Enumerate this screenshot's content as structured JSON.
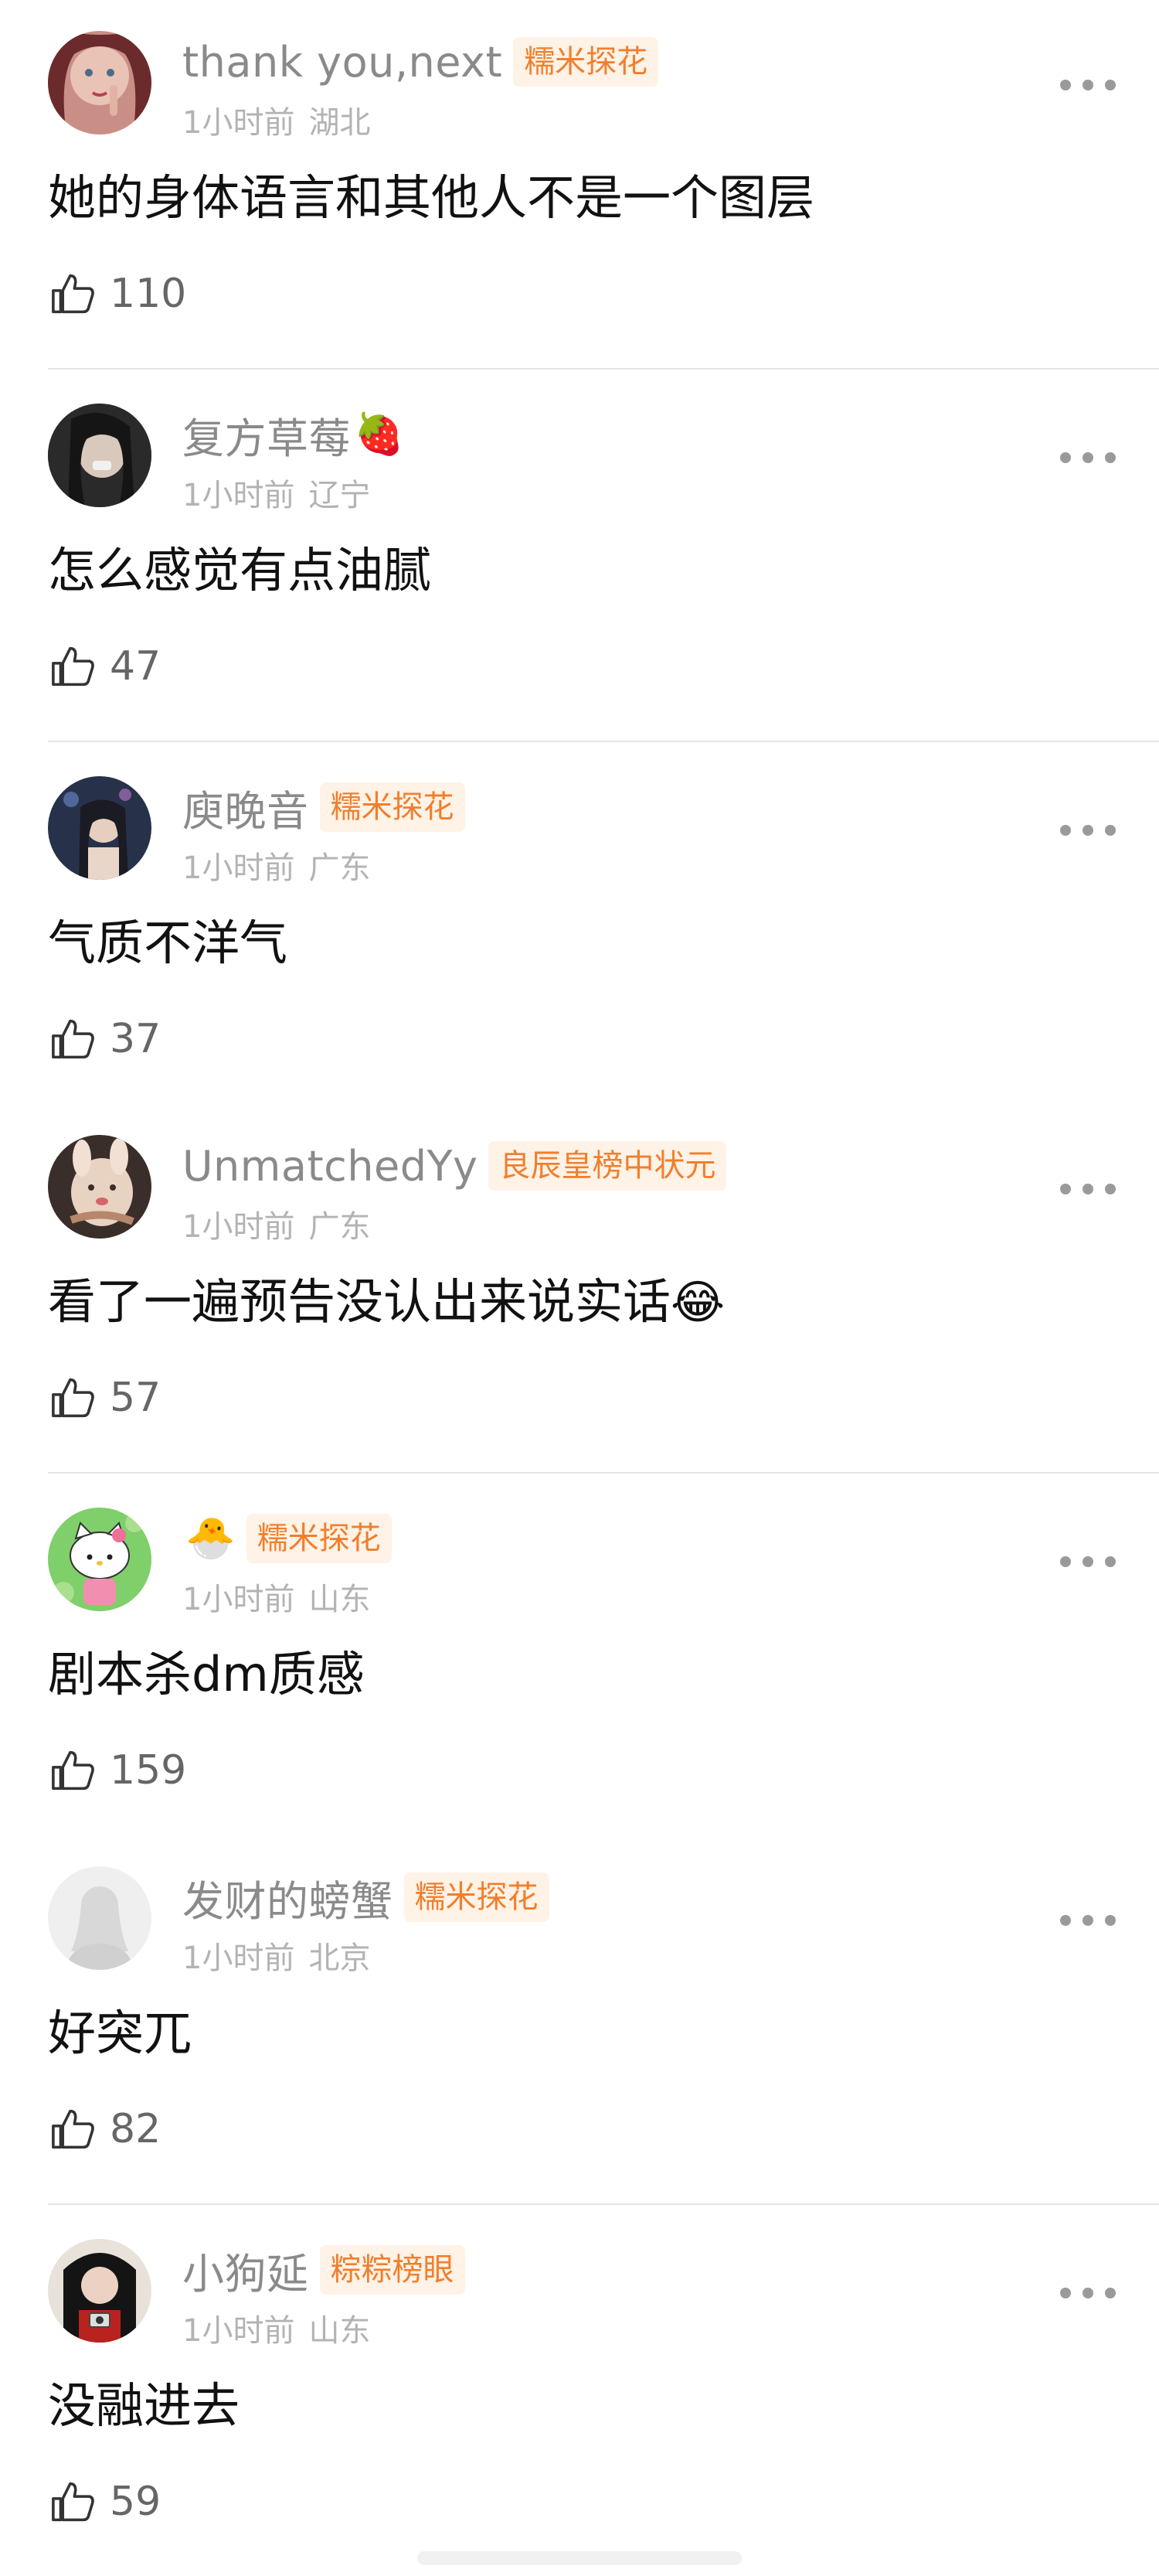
{
  "comments": [
    {
      "username": "thank you,next",
      "username_emoji": "",
      "badge": "糯米探花",
      "time": "1小时前",
      "location": "湖北",
      "text": "她的身体语言和其他人不是一个图层",
      "text_emoji": "",
      "likes": "110",
      "avatar": "avatar-woman-portrait"
    },
    {
      "username": "复方草莓",
      "username_emoji": "🍓",
      "badge": "",
      "time": "1小时前",
      "location": "辽宁",
      "text": "怎么感觉有点油腻",
      "text_emoji": "",
      "likes": "47",
      "avatar": "avatar-dark-portrait"
    },
    {
      "username": "庾晚音",
      "username_emoji": "",
      "badge": "糯米探花",
      "time": "1小时前",
      "location": "广东",
      "text": "气质不洋气",
      "text_emoji": "",
      "likes": "37",
      "avatar": "avatar-night-portrait"
    },
    {
      "username": "UnmatchedYy",
      "username_emoji": "",
      "badge": "良辰皇榜中状元",
      "time": "1小时前",
      "location": "广东",
      "text": "看了一遍预告没认出来说实话",
      "text_emoji": "😂",
      "likes": "57",
      "avatar": "avatar-plush-toy"
    },
    {
      "username": "",
      "username_emoji": "🐣",
      "badge": "糯米探花",
      "time": "1小时前",
      "location": "山东",
      "text": "剧本杀dm质感",
      "text_emoji": "",
      "likes": "159",
      "avatar": "avatar-hello-kitty"
    },
    {
      "username": "发财的螃蟹",
      "username_emoji": "",
      "badge": "糯米探花",
      "time": "1小时前",
      "location": "北京",
      "text": "好突兀",
      "text_emoji": "",
      "likes": "82",
      "avatar": "avatar-default-silhouette"
    },
    {
      "username": "小狗延",
      "username_emoji": "",
      "badge": "粽粽榜眼",
      "time": "1小时前",
      "location": "山东",
      "text": "没融进去",
      "text_emoji": "",
      "likes": "59",
      "avatar": "avatar-girl-camera"
    }
  ],
  "icons": {
    "like": "thumbs-up-icon",
    "more": "more-horizontal-icon"
  },
  "colors": {
    "username": "#8a8a8a",
    "badge_text": "#f07f2d",
    "badge_bg": "#fff2e6",
    "meta": "#b3b3b3",
    "text": "#111111",
    "divider": "#e6e6e6"
  }
}
